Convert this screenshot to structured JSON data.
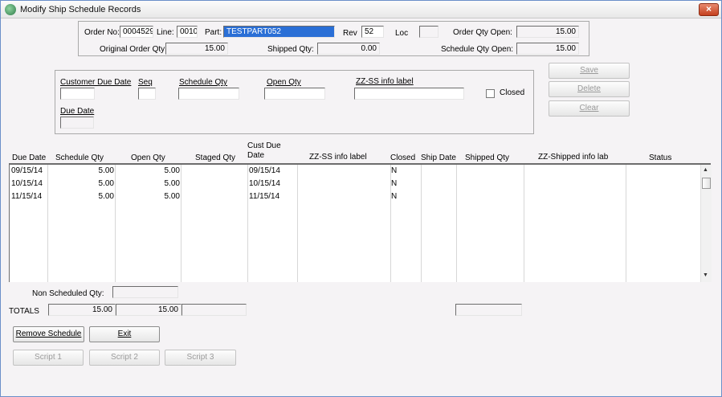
{
  "window": {
    "title": "Modify Ship Schedule Records",
    "close_glyph": "×"
  },
  "header": {
    "order_no_label": "Order No:",
    "order_no": "0004529",
    "line_label": "Line:",
    "line": "0010",
    "part_label": "Part:",
    "part": "TESTPART052",
    "rev_label": "Rev",
    "rev": "52",
    "loc_label": "Loc",
    "loc": "",
    "order_qty_open_label": "Order Qty Open:",
    "order_qty_open": "15.00",
    "original_order_qty_label": "Original Order Qty:",
    "original_order_qty": "15.00",
    "shipped_qty_label": "Shipped Qty:",
    "shipped_qty": "0.00",
    "schedule_qty_open_label": "Schedule Qty Open:",
    "schedule_qty_open": "15.00"
  },
  "edit": {
    "customer_due_date_label": "Customer Due Date",
    "seq_label": "Seq",
    "schedule_qty_label": "Schedule Qty",
    "open_qty_label": "Open Qty",
    "zz_ss_label": "ZZ-SS info label",
    "closed_label": "Closed",
    "due_date_label": "Due Date"
  },
  "actions": {
    "save": "Save",
    "delete": "Delete",
    "clear": "Clear"
  },
  "grid": {
    "columns": [
      "Due Date",
      "Schedule Qty",
      "Open Qty",
      "Staged Qty",
      "Cust Due Date",
      "ZZ-SS info label",
      "Closed",
      "Ship Date",
      "Shipped Qty",
      "ZZ-Shipped info lab",
      "Status"
    ],
    "cust_due_line1": "Cust Due",
    "cust_due_line2": "Date",
    "rows": [
      {
        "due_date": "09/15/14",
        "schedule_qty": "5.00",
        "open_qty": "5.00",
        "staged_qty": "",
        "cust_due_date": "09/15/14",
        "zz_ss": "",
        "closed": "N",
        "ship_date": "",
        "shipped_qty": "",
        "zz_shipped": "",
        "status": ""
      },
      {
        "due_date": "10/15/14",
        "schedule_qty": "5.00",
        "open_qty": "5.00",
        "staged_qty": "",
        "cust_due_date": "10/15/14",
        "zz_ss": "",
        "closed": "N",
        "ship_date": "",
        "shipped_qty": "",
        "zz_shipped": "",
        "status": ""
      },
      {
        "due_date": "11/15/14",
        "schedule_qty": "5.00",
        "open_qty": "5.00",
        "staged_qty": "",
        "cust_due_date": "11/15/14",
        "zz_ss": "",
        "closed": "N",
        "ship_date": "",
        "shipped_qty": "",
        "zz_shipped": "",
        "status": ""
      }
    ]
  },
  "footer": {
    "non_scheduled_qty_label": "Non Scheduled Qty:",
    "non_scheduled_qty": "",
    "totals_label": "TOTALS",
    "total_schedule_qty": "15.00",
    "total_open_qty": "15.00",
    "total_staged_qty": "",
    "total_shipped_qty": ""
  },
  "buttons": {
    "remove_schedule": "Remove Schedule",
    "exit": "Exit",
    "script1": "Script 1",
    "script2": "Script 2",
    "script3": "Script 3"
  }
}
